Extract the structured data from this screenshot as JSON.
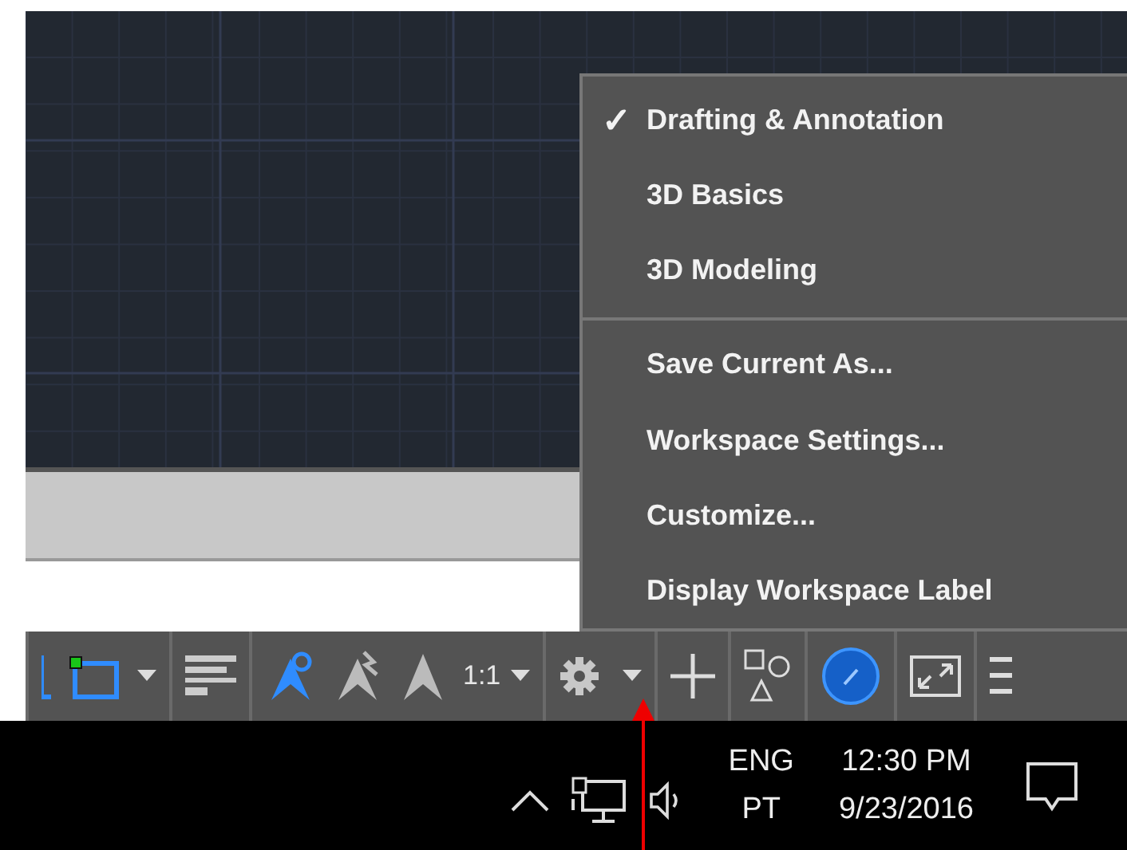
{
  "menu": {
    "check_mark": "✓",
    "workspaces": [
      {
        "label": "Drafting & Annotation",
        "checked": true
      },
      {
        "label": "3D Basics",
        "checked": false
      },
      {
        "label": "3D Modeling",
        "checked": false
      }
    ],
    "commands": [
      "Save Current As...",
      "Workspace Settings...",
      "Customize...",
      "Display Workspace Label"
    ]
  },
  "status_bar": {
    "scale": "1:1"
  },
  "taskbar": {
    "language": "ENG",
    "layout": "PT",
    "time": "12:30 PM",
    "date": "9/23/2016"
  }
}
